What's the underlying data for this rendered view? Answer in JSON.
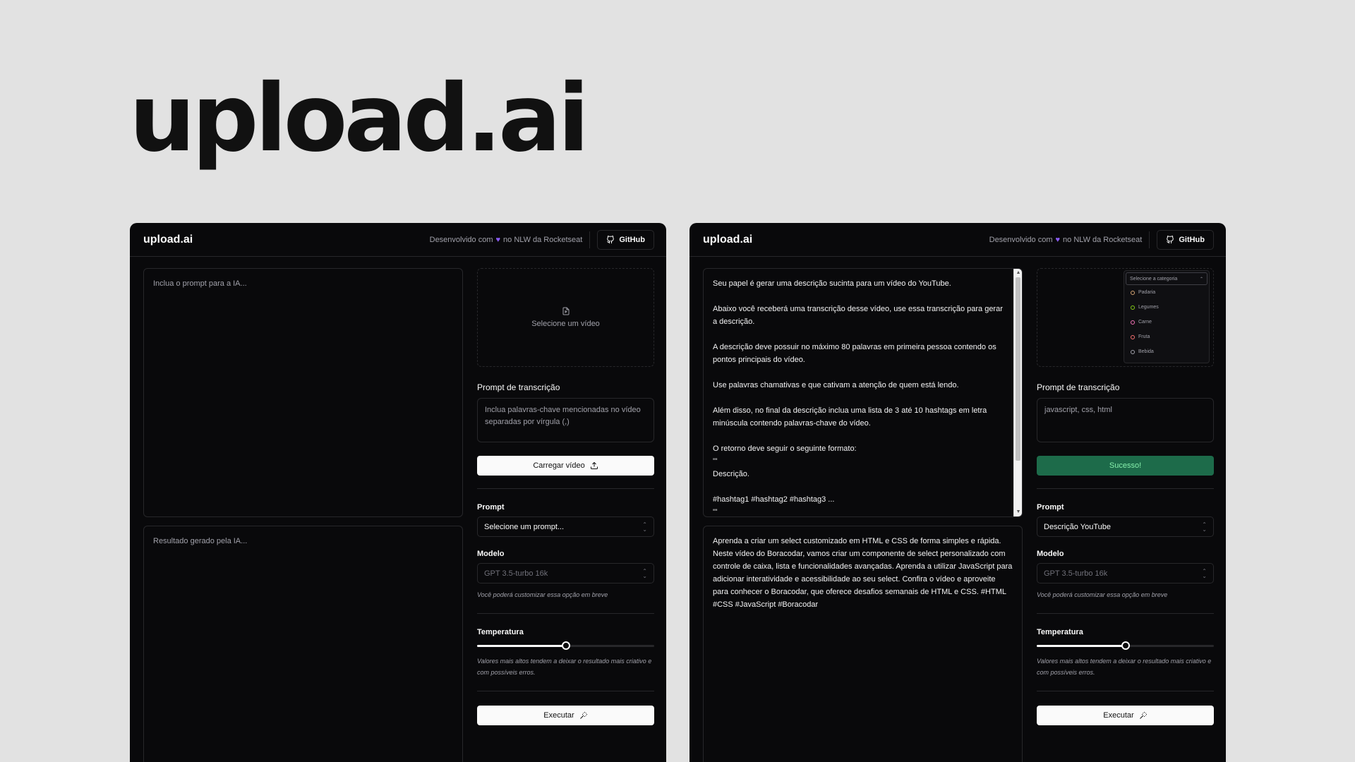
{
  "hero_title": "upload.ai",
  "header": {
    "logo": "upload.ai",
    "credit_before": "Desenvolvido com",
    "credit_after": "no NLW da Rocketseat",
    "github_label": "GitHub"
  },
  "colors": {
    "background": "#e2e2e2",
    "app_bg": "#09090b",
    "border": "#27272a",
    "heart": "#8b5cf6",
    "success": "#1d6b4a"
  },
  "icons": [
    "heart-icon",
    "github-icon",
    "file-video-icon",
    "upload-icon",
    "wand-icon",
    "chevron-updown-icon"
  ],
  "left": {
    "prompt_placeholder": "Inclua o prompt para a IA...",
    "result_placeholder": "Resultado gerado pela IA...",
    "video_label": "Selecione um vídeo",
    "transcription_label": "Prompt de transcrição",
    "transcription_placeholder": "Inclua palavras-chave mencionadas no vídeo separadas por vírgula (,)",
    "upload_button": "Carregar vídeo",
    "prompt_label": "Prompt",
    "prompt_select": "Selecione um prompt...",
    "model_label": "Modelo",
    "model_select": "GPT 3.5-turbo 16k",
    "model_hint": "Você poderá customizar essa opção em breve",
    "temperature_label": "Temperatura",
    "temperature_value": 0.5,
    "temperature_hint": "Valores mais altos tendem a deixar o resultado mais criativo e com possíveis erros.",
    "execute_button": "Executar"
  },
  "right": {
    "prompt_paragraphs": [
      "Seu papel é gerar uma descrição sucinta para um vídeo do YouTube.",
      "Abaixo você receberá uma transcrição desse vídeo, use essa transcrição para gerar a descrição.",
      "A descrição deve possuir no máximo 80 palavras em primeira pessoa contendo os pontos principais do vídeo.",
      "Use palavras chamativas e que cativam a atenção de quem está lendo.",
      "Além disso, no final da descrição inclua uma lista de 3 até 10 hashtags em letra minúscula contendo palavras-chave do vídeo."
    ],
    "format_intro": "O retorno deve seguir o seguinte formato:",
    "format_fence_open": "'''",
    "format_description": "Descrição.",
    "format_hashtags": "#hashtag1 #hashtag2 #hashtag3 ...",
    "format_fence_close": "'''",
    "result_text": "Aprenda a criar um select customizado em HTML e CSS de forma simples e rápida. Neste vídeo do Boracodar, vamos criar um componente de select personalizado com controle de caixa, lista e funcionalidades avançadas. Aprenda a utilizar JavaScript para adicionar interatividade e acessibilidade ao seu select. Confira o vídeo e aproveite para conhecer o Boracodar, que oferece desafios semanais de HTML e CSS. #HTML #CSS #JavaScript #Boracodar",
    "video_preview": {
      "trigger": "Selecione a categoria",
      "items": [
        "Padaria",
        "Legumes",
        "Carne",
        "Fruta",
        "Bebida"
      ]
    },
    "transcription_label": "Prompt de transcrição",
    "transcription_value": "javascript, css, html",
    "success_button": "Sucesso!",
    "prompt_label": "Prompt",
    "prompt_select": "Descrição YouTube",
    "model_label": "Modelo",
    "model_select": "GPT 3.5-turbo 16k",
    "model_hint": "Você poderá customizar essa opção em breve",
    "temperature_label": "Temperatura",
    "temperature_value": 0.5,
    "temperature_hint": "Valores mais altos tendem a deixar o resultado mais criativo e com possíveis erros.",
    "execute_button": "Executar"
  }
}
